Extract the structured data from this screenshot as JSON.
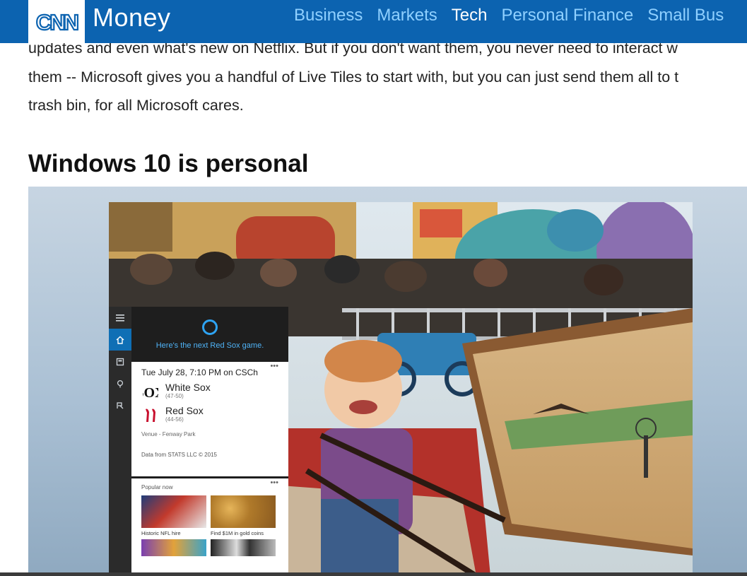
{
  "header": {
    "logo_text": "CNN",
    "brand": "Money",
    "nav": [
      {
        "label": "Business",
        "active": false
      },
      {
        "label": "Markets",
        "active": false
      },
      {
        "label": "Tech",
        "active": true
      },
      {
        "label": "Personal Finance",
        "active": false
      },
      {
        "label": "Small Bus",
        "active": false
      }
    ],
    "colors": {
      "bar": "#0c63b0",
      "nav_link": "#8fd0ff",
      "nav_active": "#ffffff"
    }
  },
  "article": {
    "paragraph_lines": [
      "updates and even what's new on Netflix. But if you don't want them, you never need to interact w",
      "them -- Microsoft gives you a handful of Live Tiles to start with, but you can just send them all to t",
      "trash bin, for all Microsoft cares."
    ],
    "heading": "Windows 10 is personal"
  },
  "cortana": {
    "prompt": "Here's the next Red Sox game.",
    "menu_icons": [
      "hamburger-icon",
      "home-icon",
      "notebook-icon",
      "location-icon",
      "feedback-icon"
    ],
    "game_card": {
      "when": "Tue July 28, 7:10 PM on CSCh",
      "teams": [
        {
          "name": "White Sox",
          "record": "(47-50)",
          "logo": "SOX"
        },
        {
          "name": "Red Sox",
          "record": "(44-56)",
          "logo": "B"
        }
      ],
      "venue": "Venue - Fenway Park",
      "credit": "Data from STATS LLC © 2015"
    },
    "popular": {
      "title": "Popular now",
      "items": [
        {
          "caption": "Historic NFL hire"
        },
        {
          "caption": "Find $1M in gold coins"
        }
      ]
    },
    "more_glyph": "•••"
  }
}
